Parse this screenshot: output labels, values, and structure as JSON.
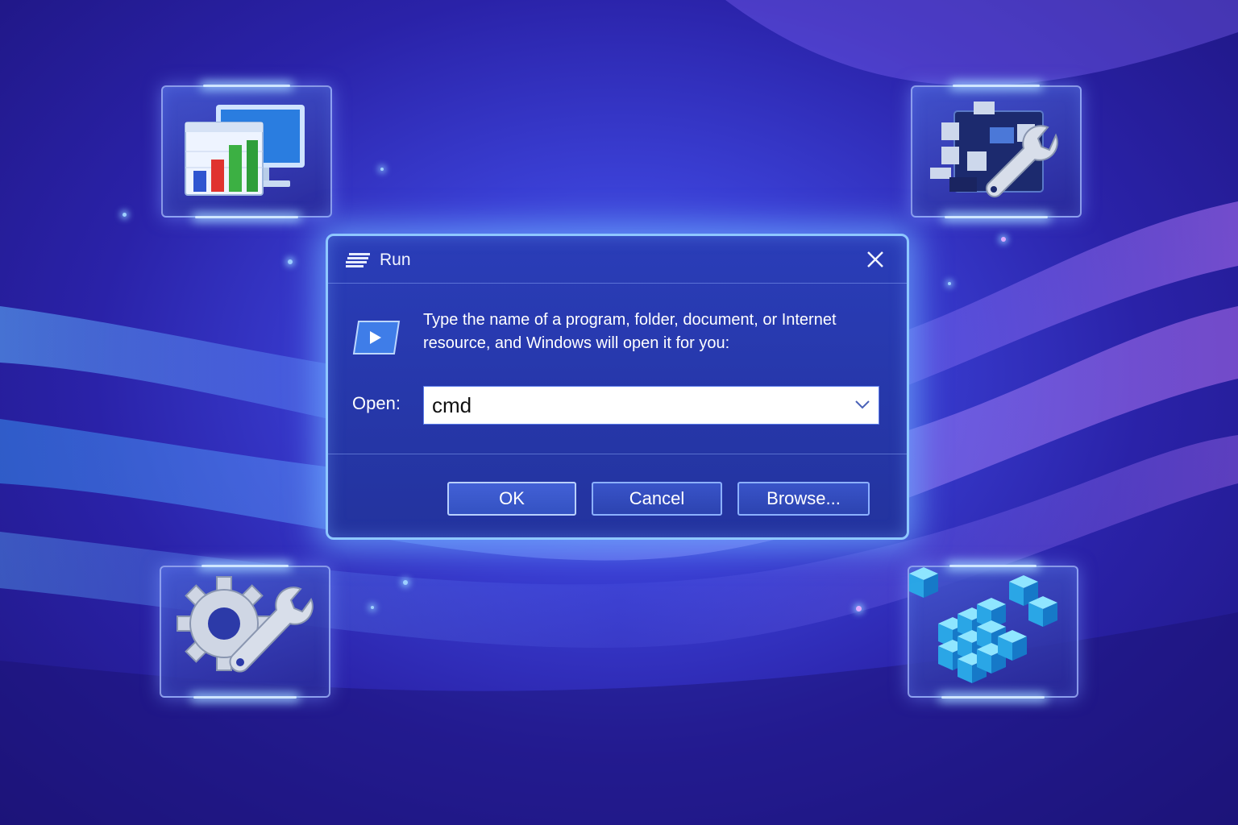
{
  "dialog": {
    "title": "Run",
    "description": "Type the name of a program, folder, document, or Internet resource, and Windows will open it for you:",
    "open_label": "Open:",
    "open_value": "cmd",
    "buttons": {
      "ok": "OK",
      "cancel": "Cancel",
      "browse": "Browse..."
    }
  },
  "tiles": [
    {
      "icon": "performance-monitor-icon"
    },
    {
      "icon": "system-tools-icon"
    },
    {
      "icon": "settings-gear-wrench-icon"
    },
    {
      "icon": "registry-cubes-icon"
    }
  ],
  "colors": {
    "accent": "#8fc8ff",
    "dialog_bg": "#2a3db8",
    "background": "#3a3fd4"
  }
}
